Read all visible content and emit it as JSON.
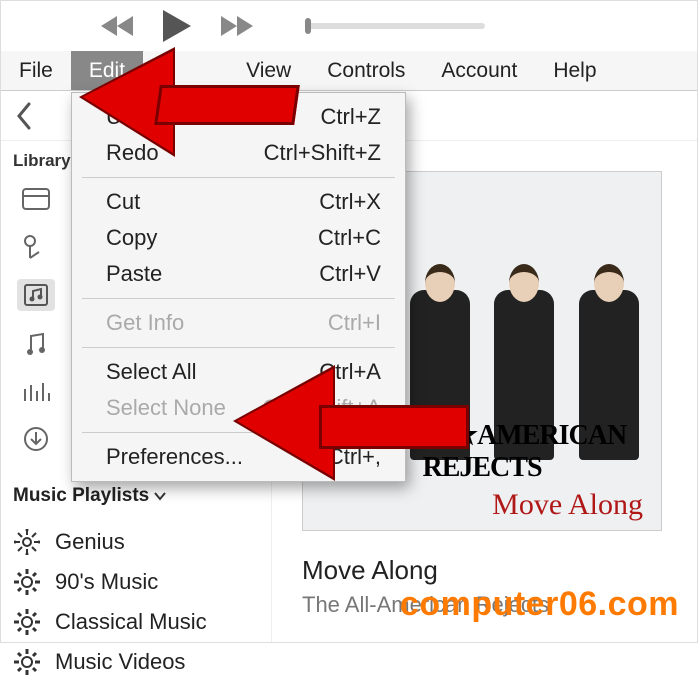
{
  "menubar": {
    "items": [
      "File",
      "Edit",
      "View",
      "Controls",
      "Account",
      "Help"
    ],
    "active_index": 1
  },
  "sidebar": {
    "library_label": "Library",
    "playlists_label": "Music Playlists",
    "playlists": [
      "Genius",
      "90's Music",
      "Classical Music",
      "Music Videos"
    ]
  },
  "dropdown": {
    "groups": [
      [
        {
          "label": "Undo",
          "shortcut": "Ctrl+Z",
          "disabled": false
        },
        {
          "label": "Redo",
          "shortcut": "Ctrl+Shift+Z",
          "disabled": false
        }
      ],
      [
        {
          "label": "Cut",
          "shortcut": "Ctrl+X",
          "disabled": false
        },
        {
          "label": "Copy",
          "shortcut": "Ctrl+C",
          "disabled": false
        },
        {
          "label": "Paste",
          "shortcut": "Ctrl+V",
          "disabled": false
        }
      ],
      [
        {
          "label": "Get Info",
          "shortcut": "Ctrl+I",
          "disabled": true
        }
      ],
      [
        {
          "label": "Select All",
          "shortcut": "Ctrl+A",
          "disabled": false
        },
        {
          "label": "Select None",
          "shortcut": "Ctrl+Shift+A",
          "disabled": true
        }
      ],
      [
        {
          "label": "Preferences...",
          "shortcut": "Ctrl+,",
          "disabled": false
        }
      ]
    ]
  },
  "album": {
    "art_line1": "THE ALL★AMERICAN REJECTS",
    "art_line2": "Move Along",
    "track_title": "Move Along",
    "track_artist": "The All-American Rejects"
  },
  "watermark": "computer06.com"
}
